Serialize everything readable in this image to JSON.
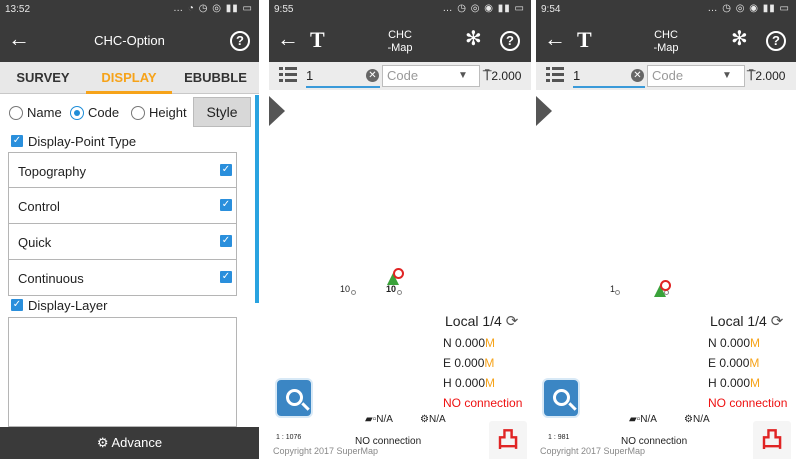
{
  "panel1": {
    "status_time": "13:52",
    "title": "CHC-Option",
    "tabs": [
      "SURVEY",
      "DISPLAY",
      "EBUBBLE"
    ],
    "active_tab": "DISPLAY",
    "radio_options": [
      "Name",
      "Code",
      "Height"
    ],
    "selected_radio": "Code",
    "style_button": "Style",
    "point_type_header": "Display-Point Type",
    "point_types": [
      {
        "label": "Topography",
        "checked": true
      },
      {
        "label": "Control",
        "checked": true
      },
      {
        "label": "Quick",
        "checked": true
      },
      {
        "label": "Continuous",
        "checked": true
      }
    ],
    "layer_header": "Display-Layer",
    "advance_button": "Advance"
  },
  "panel2": {
    "status_time": "9:55",
    "title": "CHC\n-Map",
    "point_name": "1",
    "code_placeholder": "Code",
    "rod_height": "2.000",
    "point_labels": [
      "10",
      "10"
    ],
    "local": "Local 1/4",
    "north": "N 0.000",
    "east": "E 0.000",
    "height": "H 0.000",
    "unit": "M",
    "status": "NO connection",
    "sat_a": "N/A",
    "sat_b": "N/A",
    "scale": "1 : 1076",
    "bottom_status": "NO connection",
    "copyright": "Copyright 2017 SuperMap"
  },
  "panel3": {
    "status_time": "9:54",
    "title": "CHC\n-Map",
    "point_name": "1",
    "code_placeholder": "Code",
    "rod_height": "2.000",
    "point_labels": [
      "1"
    ],
    "local": "Local 1/4",
    "north": "N 0.000",
    "east": "E 0.000",
    "height": "H 0.000",
    "unit": "M",
    "status": "NO connection",
    "sat_a": "N/A",
    "sat_b": "N/A",
    "scale": "1 : 981",
    "bottom_status": "NO connection",
    "copyright": "Copyright 2017 SuperMap"
  },
  "colors": {
    "accent": "#f6a31a",
    "titlebar": "#3a3a3a",
    "check": "#2a8fdc",
    "error": "#e02424"
  }
}
